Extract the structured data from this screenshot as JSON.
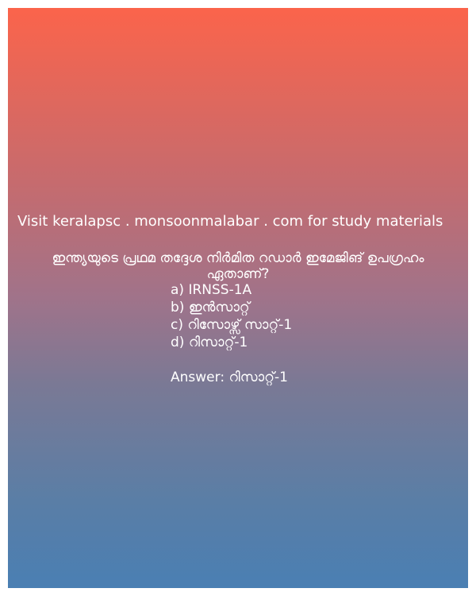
{
  "site_line": "Visit keralapsc . monsoonmalabar . com for study materials",
  "question": {
    "line1": "ഇന്ത്യയുടെ പ്രഥമ തദ്ദേശ നിർമിത റഡാർ ഇമേജിങ് ഉപഗ്രഹം",
    "line2": "ഏതാണ്?"
  },
  "options": [
    "a) IRNSS-1A",
    "b) ഇൻസാറ്റ്",
    "c) റിസോഴ്സ് സാറ്റ്-1",
    "d) റിസാറ്റ്-1"
  ],
  "answer": "Answer: റിസാറ്റ്-1",
  "colors": {
    "gradient_top": "#fb644b",
    "gradient_bottom": "#4a7fb3",
    "text": "#ffffff"
  }
}
